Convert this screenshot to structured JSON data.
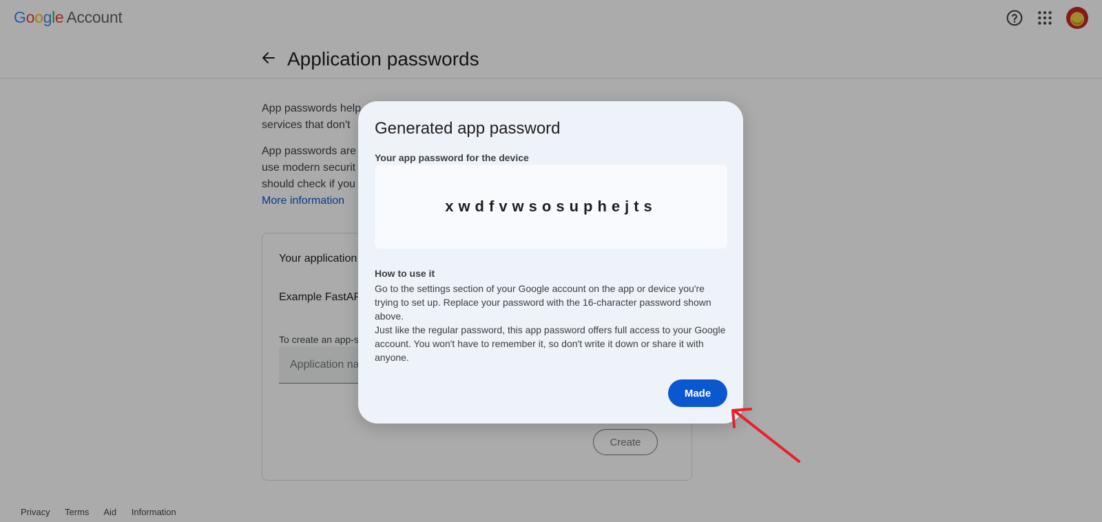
{
  "header": {
    "logo_parts": [
      "G",
      "o",
      "o",
      "g",
      "l",
      "e"
    ],
    "account_label": "Account",
    "help_icon": "help-circle-icon",
    "apps_icon": "apps-grid-icon",
    "avatar_icon": "user-avatar"
  },
  "page": {
    "title": "Application passwords",
    "back_icon": "arrow-back-icon"
  },
  "intro": {
    "para1": "App passwords help",
    "para1_line2": "services that don't",
    "para2_line1": "App passwords are",
    "para2_line2": "use modern securit",
    "para2_line3": "should check if you",
    "more_link": "More information"
  },
  "card": {
    "title": "Your application",
    "item": "Example FastAP",
    "hint": "To create an app-s",
    "input_placeholder": "Application na",
    "create_label": "Create"
  },
  "footer": {
    "links": [
      "Privacy",
      "Terms",
      "Aid",
      "Information"
    ]
  },
  "dialog": {
    "title": "Generated app password",
    "subtitle": "Your app password for the device",
    "password": "xwdfvwsosuphejts",
    "howto_title": "How to use it",
    "howto_p1": "Go to the settings section of your Google account on the app or device you're trying to set up. Replace your password with the 16-character password shown above.",
    "howto_p2": "Just like the regular password, this app password offers full access to your Google account. You won't have to remember it, so don't write it down or share it with anyone.",
    "done_label": "Made"
  },
  "colors": {
    "accent": "#0b57d0",
    "annotation_arrow": "#e8202a"
  }
}
